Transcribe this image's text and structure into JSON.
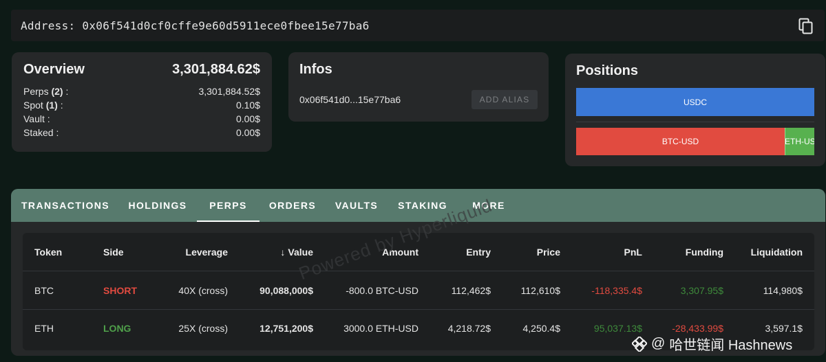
{
  "address": {
    "label": "Address:",
    "value": "0x06f541d0cf0cffe9e60d5911ece0fbee15e77ba6",
    "icon": "copy-icon"
  },
  "overview": {
    "title": "Overview",
    "total": "3,301,884.62$",
    "rows": [
      {
        "label": "Perps",
        "count": "(2)",
        "suffix": " :",
        "value": "3,301,884.52$"
      },
      {
        "label": "Spot",
        "count": "(1)",
        "suffix": " :",
        "value": "0.10$"
      },
      {
        "label": "Vault",
        "count": "",
        "suffix": " :",
        "value": "0.00$"
      },
      {
        "label": "Staked",
        "count": "",
        "suffix": " :",
        "value": "0.00$"
      }
    ]
  },
  "infos": {
    "title": "Infos",
    "short_address": "0x06f541d0...15e77ba6",
    "alias_button": "ADD ALIAS"
  },
  "positions": {
    "title": "Positions",
    "spot": [
      {
        "label": "USDC",
        "share": 1.0,
        "color": "#3a78d6"
      }
    ],
    "perps": [
      {
        "label": "BTC-USD",
        "share": 0.876,
        "color": "#e14b40"
      },
      {
        "label": "ETH-USD",
        "share": 0.124,
        "color": "#58b14f"
      }
    ]
  },
  "tabs": [
    {
      "label": "TRANSACTIONS",
      "active": false
    },
    {
      "label": "HOLDINGS",
      "active": false
    },
    {
      "label": "PERPS",
      "active": true
    },
    {
      "label": "ORDERS",
      "active": false
    },
    {
      "label": "VAULTS",
      "active": false
    },
    {
      "label": "STAKING",
      "active": false
    },
    {
      "label": "MORE",
      "active": false
    }
  ],
  "table": {
    "headers": [
      "Token",
      "Side",
      "Leverage",
      "Value",
      "Amount",
      "Entry",
      "Price",
      "PnL",
      "Funding",
      "Liquidation"
    ],
    "sort_arrow": "↓",
    "rows": [
      [
        "BTC",
        "SHORT",
        "40X (cross)",
        "90,088,000$",
        "-800.0 BTC-USD",
        "112,462$",
        "112,610$",
        "-118,335.4$",
        "3,307.95$",
        "114,980$"
      ],
      [
        "ETH",
        "LONG",
        "25X (cross)",
        "12,751,200$",
        "3000.0 ETH-USD",
        "4,218.72$",
        "4,250.4$",
        "95,037.13$",
        "-28,433.99$",
        "3,597.1$"
      ]
    ]
  },
  "watermark": "Powered by Hyperliquid",
  "brand": {
    "at": "@",
    "name": "哈世链闻 Hashnews"
  }
}
